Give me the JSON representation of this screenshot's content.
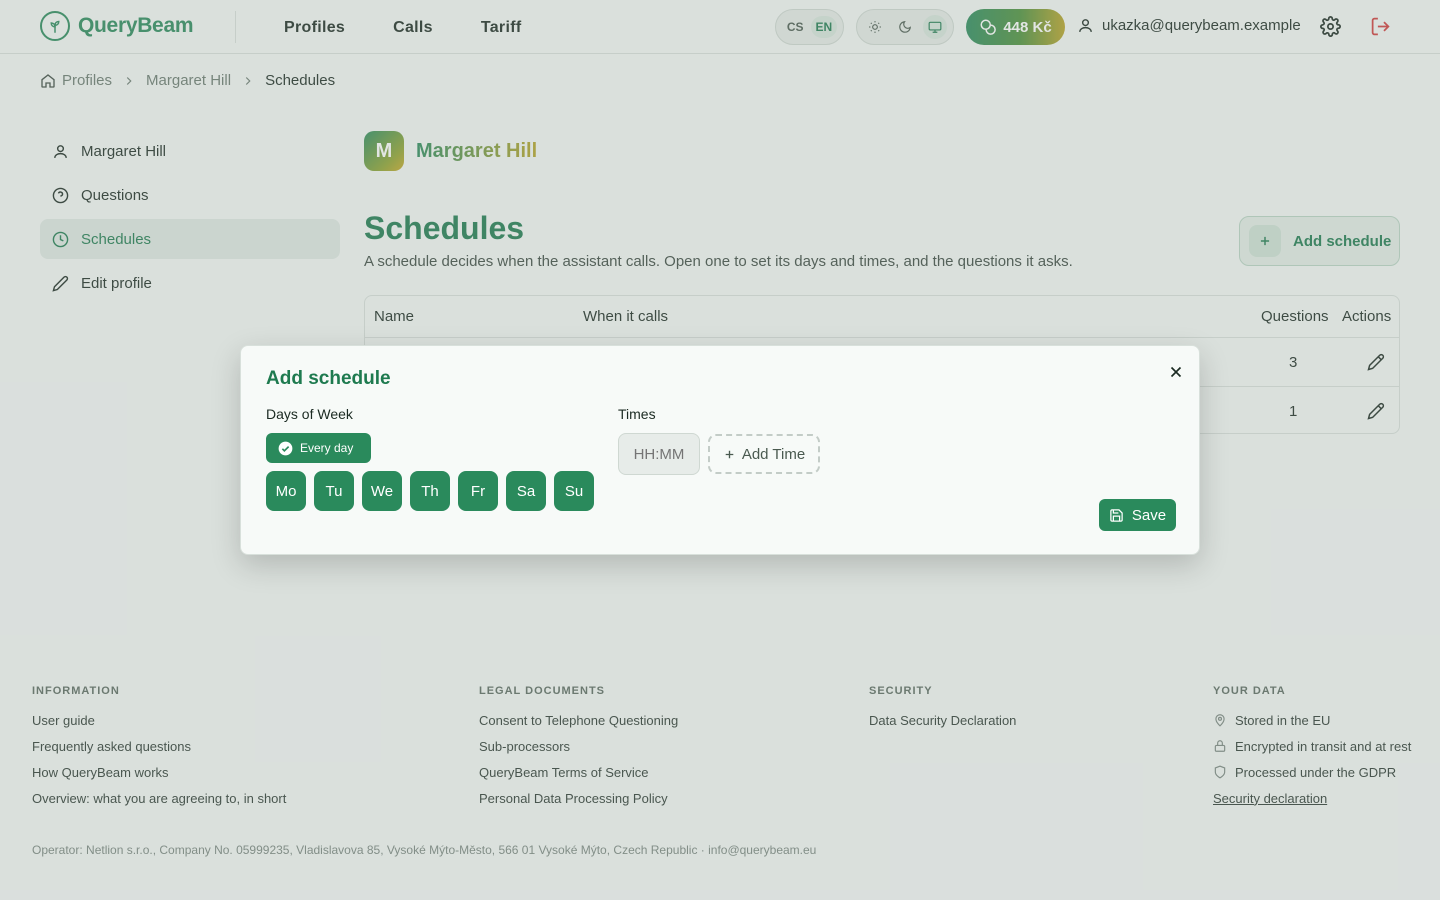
{
  "app": {
    "name": "QueryBeam"
  },
  "nav": {
    "items": [
      "Profiles",
      "Calls",
      "Tariff"
    ]
  },
  "header": {
    "languages": [
      "CS",
      "EN"
    ],
    "active_language": "EN",
    "theme_icons": [
      "sun-icon",
      "moon-icon",
      "monitor-icon"
    ],
    "credit": "448 Kč",
    "user_email": "ukazka@querybeam.example"
  },
  "breadcrumb": {
    "items": [
      "Profiles",
      "Margaret Hill",
      "Schedules"
    ]
  },
  "sidebar": {
    "items": [
      {
        "label": "Margaret Hill",
        "icon": "user-icon"
      },
      {
        "label": "Questions",
        "icon": "help-circle-icon"
      },
      {
        "label": "Schedules",
        "icon": "clock-icon",
        "active": true
      },
      {
        "label": "Edit profile",
        "icon": "pencil-icon"
      }
    ]
  },
  "profile": {
    "initial": "M",
    "name": "Margaret Hill"
  },
  "page": {
    "title": "Schedules",
    "description": "A schedule decides when the assistant calls. Open one to set its days and times, and the questions it asks.",
    "add_button": "Add schedule"
  },
  "table": {
    "columns": [
      "Name",
      "When it calls",
      "Questions",
      "Actions"
    ],
    "rows": [
      {
        "questions": "3"
      },
      {
        "questions": "1"
      }
    ]
  },
  "modal": {
    "title": "Add schedule",
    "days_label": "Days of Week",
    "times_label": "Times",
    "every_day": "Every day",
    "days": [
      "Mo",
      "Tu",
      "We",
      "Th",
      "Fr",
      "Sa",
      "Su"
    ],
    "time_placeholder": "HH:MM",
    "add_time": "Add Time",
    "save": "Save"
  },
  "footer": {
    "information": {
      "heading": "INFORMATION",
      "links": [
        "User guide",
        "Frequently asked questions",
        "How QueryBeam works",
        "Overview: what you are agreeing to, in short"
      ]
    },
    "legal": {
      "heading": "LEGAL DOCUMENTS",
      "links": [
        "Consent to Telephone Questioning",
        "Sub-processors",
        "QueryBeam Terms of Service",
        "Personal Data Processing Policy"
      ]
    },
    "security": {
      "heading": "SECURITY",
      "links": [
        "Data Security Declaration"
      ]
    },
    "your_data": {
      "heading": "YOUR DATA",
      "items": [
        "Stored in the EU",
        "Encrypted in transit and at rest",
        "Processed under the GDPR"
      ],
      "link": "Security declaration"
    },
    "operator": "Operator: Netlion s.r.o., Company No. 05999235, Vladislavova 85, Vysoké Mýto-Město, 566 01 Vysoké Mýto, Czech Republic · info@querybeam.eu"
  },
  "colors": {
    "primary": "#2a8a5c",
    "accent": "#b5a326",
    "danger": "#d03b3b"
  }
}
